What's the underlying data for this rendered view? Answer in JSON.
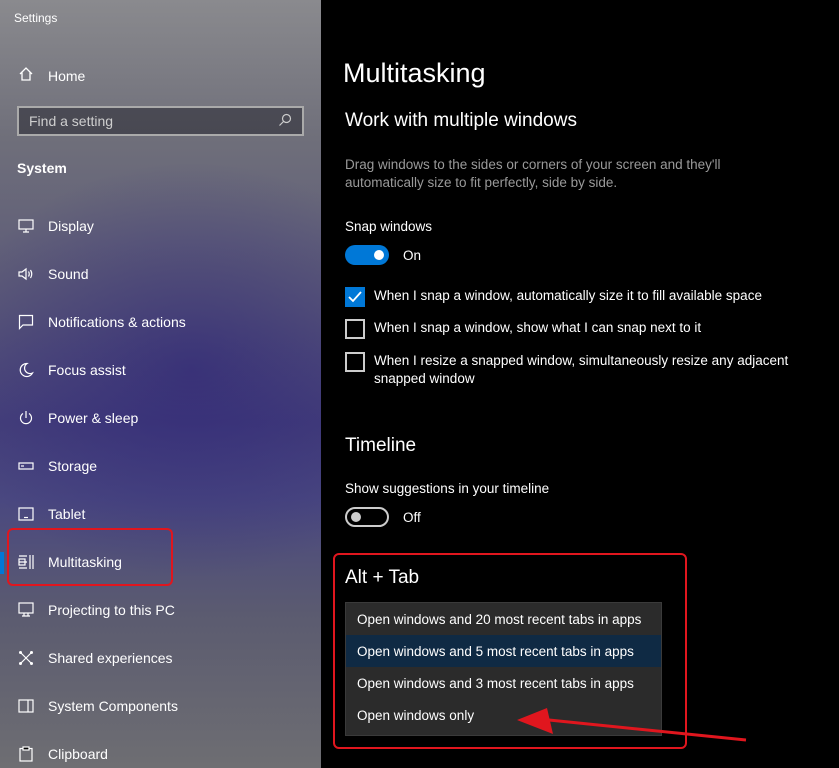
{
  "window": {
    "title": "Settings"
  },
  "sidebar": {
    "home_label": "Home",
    "search_placeholder": "Find a setting",
    "section": "System",
    "items": [
      {
        "label": "Display",
        "icon": "display-icon"
      },
      {
        "label": "Sound",
        "icon": "sound-icon"
      },
      {
        "label": "Notifications & actions",
        "icon": "notifications-icon"
      },
      {
        "label": "Focus assist",
        "icon": "moon-icon"
      },
      {
        "label": "Power & sleep",
        "icon": "power-icon"
      },
      {
        "label": "Storage",
        "icon": "storage-icon"
      },
      {
        "label": "Tablet",
        "icon": "tablet-icon"
      },
      {
        "label": "Multitasking",
        "icon": "multitasking-icon",
        "active": true
      },
      {
        "label": "Projecting to this PC",
        "icon": "projecting-icon"
      },
      {
        "label": "Shared experiences",
        "icon": "shared-icon"
      },
      {
        "label": "System Components",
        "icon": "components-icon"
      },
      {
        "label": "Clipboard",
        "icon": "clipboard-icon"
      }
    ]
  },
  "main": {
    "title": "Multitasking",
    "windows": {
      "heading": "Work with multiple windows",
      "description": "Drag windows to the sides or corners of your screen and they'll automatically size to fit perfectly, side by side.",
      "snap_label": "Snap windows",
      "snap_state": "On",
      "checks": [
        {
          "label": "When I snap a window, automatically size it to fill available space",
          "checked": true
        },
        {
          "label": "When I snap a window, show what I can snap next to it",
          "checked": false
        },
        {
          "label": "When I resize a snapped window, simultaneously resize any adjacent snapped window",
          "checked": false
        }
      ]
    },
    "timeline": {
      "heading": "Timeline",
      "suggestions_label": "Show suggestions in your timeline",
      "suggestions_state": "Off"
    },
    "alttab": {
      "heading": "Alt + Tab",
      "options": [
        "Open windows and 20 most recent tabs in apps",
        "Open windows and 5 most recent tabs in apps",
        "Open windows and 3 most recent tabs in apps",
        "Open windows only"
      ],
      "highlighted_index": 1
    }
  },
  "colors": {
    "accent": "#0078d7",
    "annotation": "#e0161e"
  }
}
